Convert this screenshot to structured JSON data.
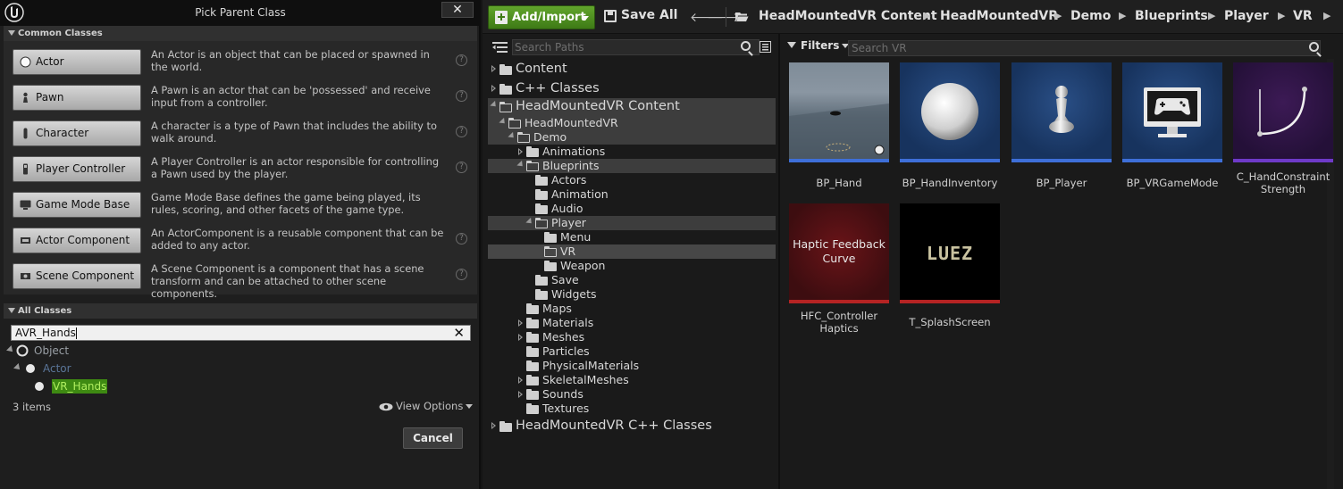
{
  "dialog": {
    "title": "Pick Parent Class",
    "close_label": "✕",
    "common_header": "Common Classes",
    "common_classes": [
      {
        "label": "Actor",
        "desc": "An Actor is an object that can be placed or spawned in the world."
      },
      {
        "label": "Pawn",
        "desc": "A Pawn is an actor that can be 'possessed' and receive input from a controller."
      },
      {
        "label": "Character",
        "desc": "A character is a type of Pawn that includes the ability to walk around."
      },
      {
        "label": "Player Controller",
        "desc": "A Player Controller is an actor responsible for controlling a Pawn used by the player."
      },
      {
        "label": "Game Mode Base",
        "desc": "Game Mode Base defines the game being played, its rules, scoring, and other facets of the game type."
      },
      {
        "label": "Actor Component",
        "desc": "An ActorComponent is a reusable component that can be added to any actor."
      },
      {
        "label": "Scene Component",
        "desc": "A Scene Component is a component that has a scene transform and can be attached to other scene components."
      }
    ],
    "help_glyph": "?",
    "all_header": "All Classes",
    "search_value": "AVR_Hands",
    "search_clear": "✕",
    "tree": {
      "object": "Object",
      "actor": "Actor",
      "result": "VR_Hands"
    },
    "items_count": "3 items",
    "view_options": "View Options",
    "cancel_label": "Cancel"
  },
  "toolbar": {
    "add_import": "Add/Import",
    "save_all": "Save All",
    "back_arrow": "🡐",
    "forward_arrow": "🡒",
    "crumb_sep": "▶",
    "breadcrumbs": [
      "HeadMountedVR Content",
      "HeadMountedVR",
      "Demo",
      "Blueprints",
      "Player",
      "VR"
    ]
  },
  "sources": {
    "search_placeholder": "Search Paths",
    "top_items": [
      "Content",
      "C++ Classes",
      "HeadMountedVR Content"
    ],
    "tree": [
      "HeadMountedVR",
      "Demo",
      "Animations",
      "Blueprints",
      "Actors",
      "Animation",
      "Audio",
      "Player",
      "Menu",
      "VR",
      "Weapon",
      "Save",
      "Widgets",
      "Maps",
      "Materials",
      "Meshes",
      "Particles",
      "PhysicalMaterials",
      "SkeletalMeshes",
      "Sounds",
      "Textures"
    ],
    "cpp_classes": "HeadMountedVR C++ Classes"
  },
  "assets": {
    "filters_label": "Filters",
    "search_placeholder": "Search VR",
    "items": [
      {
        "name": "BP_Hand"
      },
      {
        "name": "BP_HandInventory"
      },
      {
        "name": "BP_Player"
      },
      {
        "name": "BP_VRGameMode"
      },
      {
        "name": "C_HandConstraint Strength"
      },
      {
        "name": "HFC_Controller Haptics",
        "thumb_text": "Haptic Feedback Curve"
      },
      {
        "name": "T_SplashScreen",
        "thumb_text": "LUEZ"
      }
    ]
  },
  "colors": {
    "accent_green": "#4f8f1f",
    "blueprint_bar": "#3e6fd8",
    "curve_bar": "#6e3ac8",
    "haptic_bar": "#b52323"
  }
}
